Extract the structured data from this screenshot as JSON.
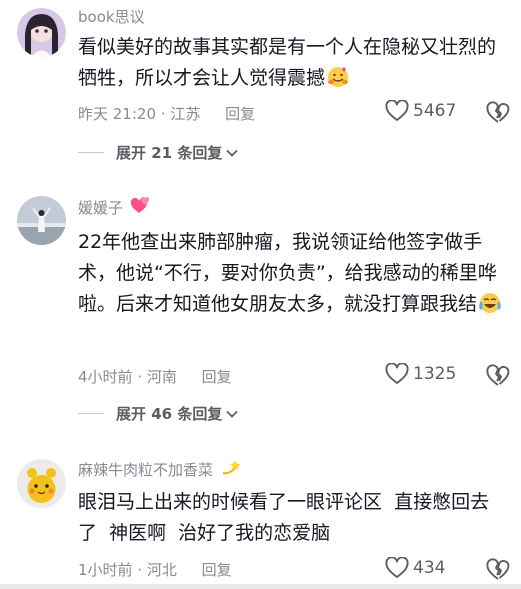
{
  "comments": [
    {
      "username": "book思议",
      "username_emoji": "",
      "text": "看似美好的故事其实都是有一个人在隐秘又壮烈的牺牲，所以才会让人觉得震撼",
      "time": "昨天 21:20",
      "location": "江苏",
      "reply_label": "回复",
      "likes": "5467",
      "expand_label": "展开 21 条回复"
    },
    {
      "username": "媛媛子",
      "username_emoji": "💕",
      "text": "22年他查出来肺部肿瘤，我说领证给他签字做手术，他说“不行，要对你负责”，给我感动的稀里哗啦。后来才知道他女朋友太多，就没打算跟我结",
      "time": "4小时前",
      "location": "河南",
      "reply_label": "回复",
      "likes": "1325",
      "expand_label": "展开 46 条回复"
    },
    {
      "username": "麻辣牛肉粒不加香菜",
      "username_emoji": "💫",
      "text": "眼泪马上出来的时候看了一眼评论区  直接憋回去了  神医啊  治好了我的恋爱脑",
      "time": "1小时前",
      "location": "河北",
      "reply_label": "回复",
      "likes": "434",
      "expand_label": ""
    }
  ],
  "icons": {
    "like": "heart-outline-icon",
    "dislike": "broken-heart-icon",
    "expand": "chevron-down-icon"
  },
  "colors": {
    "text": "#161823",
    "secondary": "#8a8b91",
    "username_emoji_pink": "#ff4f8b"
  }
}
